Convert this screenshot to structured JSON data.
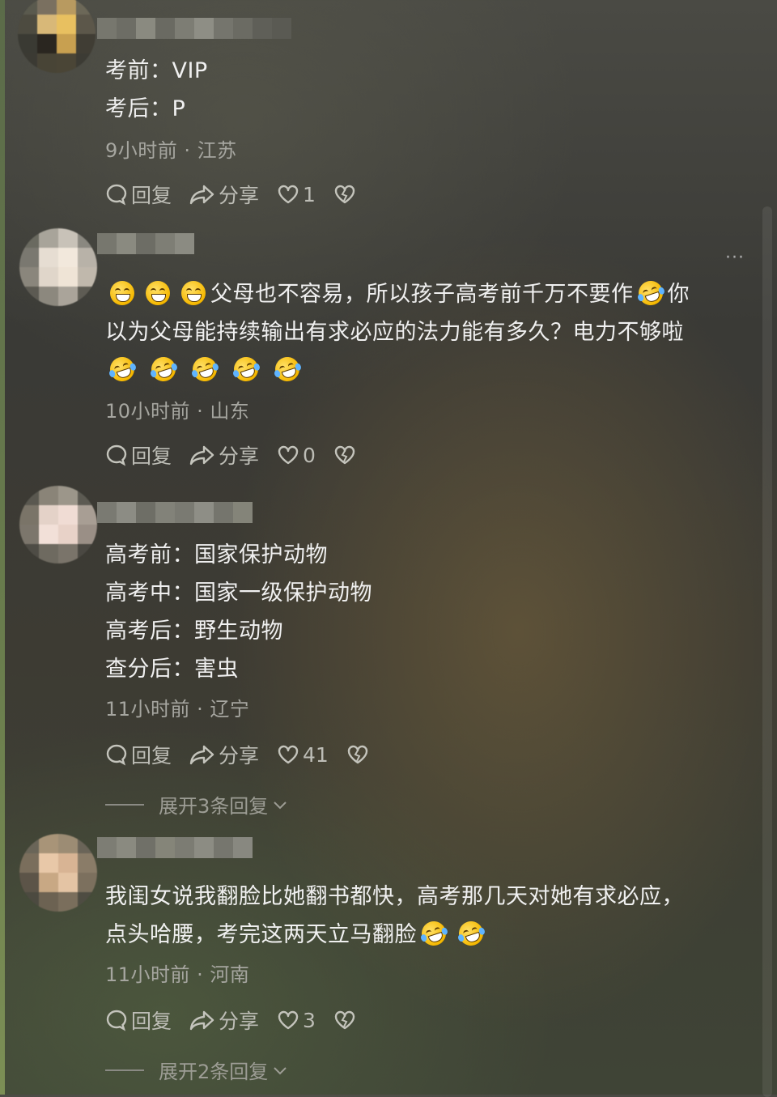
{
  "comments": [
    {
      "lines": [
        "考前：VIP",
        "考后：P"
      ],
      "meta": "9小时前 · 江苏",
      "reply_label": "回复",
      "share_label": "分享",
      "like_count": "1"
    },
    {
      "lines": [
        "父母也不容易，所以孩子高考前千万不要作",
        "你",
        "以为父母能持续输出有求必应的法力能有多久？电力不够啦"
      ],
      "meta": "10小时前 · 山东",
      "reply_label": "回复",
      "share_label": "分享",
      "like_count": "0",
      "more": "···"
    },
    {
      "lines": [
        "高考前：国家保护动物",
        "高考中：国家一级保护动物",
        "高考后：野生动物",
        "查分后：害虫"
      ],
      "meta": "11小时前 · 辽宁",
      "reply_label": "回复",
      "share_label": "分享",
      "like_count": "41",
      "expand": "展开3条回复"
    },
    {
      "lines": [
        "我闺女说我翻脸比她翻书都快，高考那几天对她有求必应，",
        "点头哈腰，考完这两天立马翻脸"
      ],
      "meta": "11小时前 · 河南",
      "reply_label": "回复",
      "share_label": "分享",
      "like_count": "3",
      "expand": "展开2条回复"
    }
  ],
  "icons": {
    "reply": "speech-bubble-icon",
    "share": "share-arrow-icon",
    "like": "heart-icon",
    "dislike": "broken-heart-icon",
    "expand": "chevron-down-icon",
    "emoji_grin": "grinning-emoji",
    "emoji_laugh": "rolling-laughing-emoji"
  },
  "colors": {
    "text": "#f0f0f0",
    "meta": "#a6a6a0",
    "action": "#bdbdb6"
  }
}
